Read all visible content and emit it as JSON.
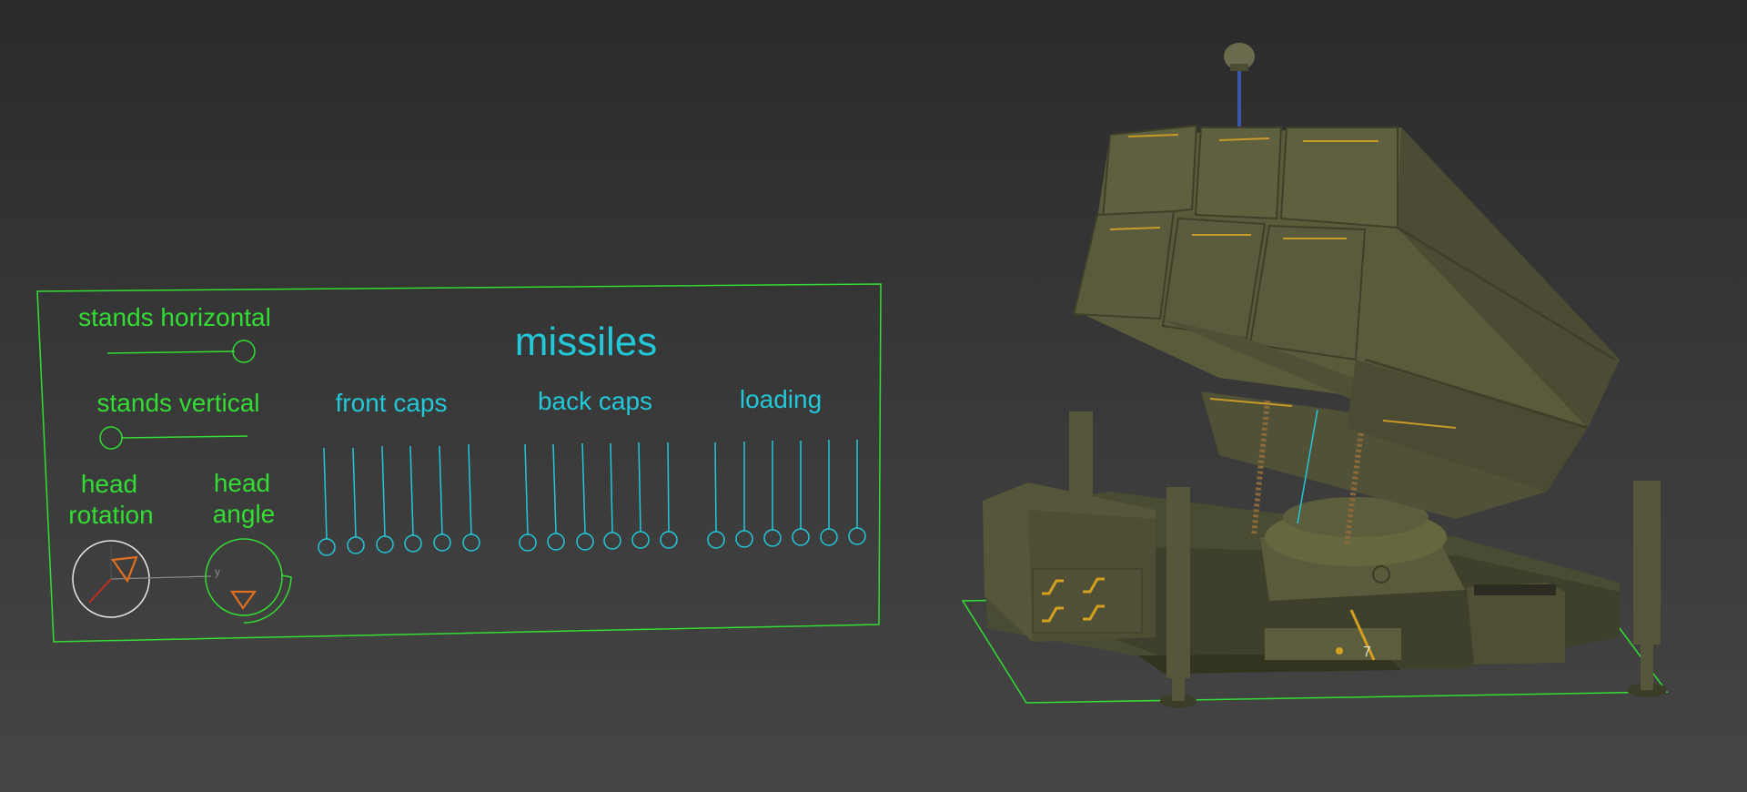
{
  "panel": {
    "stands_horizontal": "stands horizontal",
    "stands_vertical": "stands vertical",
    "head_rotation_line1": "head",
    "head_rotation_line2": "rotation",
    "head_angle_line1": "head",
    "head_angle_line2": "angle",
    "missiles_title": "missiles",
    "front_caps": "front caps",
    "back_caps": "back caps",
    "loading": "loading",
    "gizmo_axis_y": "y"
  },
  "vehicle": {
    "plate_number": "7"
  },
  "colors": {
    "green": "#33dd33",
    "cyan": "#22c8d8",
    "orange": "#e07020",
    "vehicle_olive": "#5c5d3c"
  }
}
